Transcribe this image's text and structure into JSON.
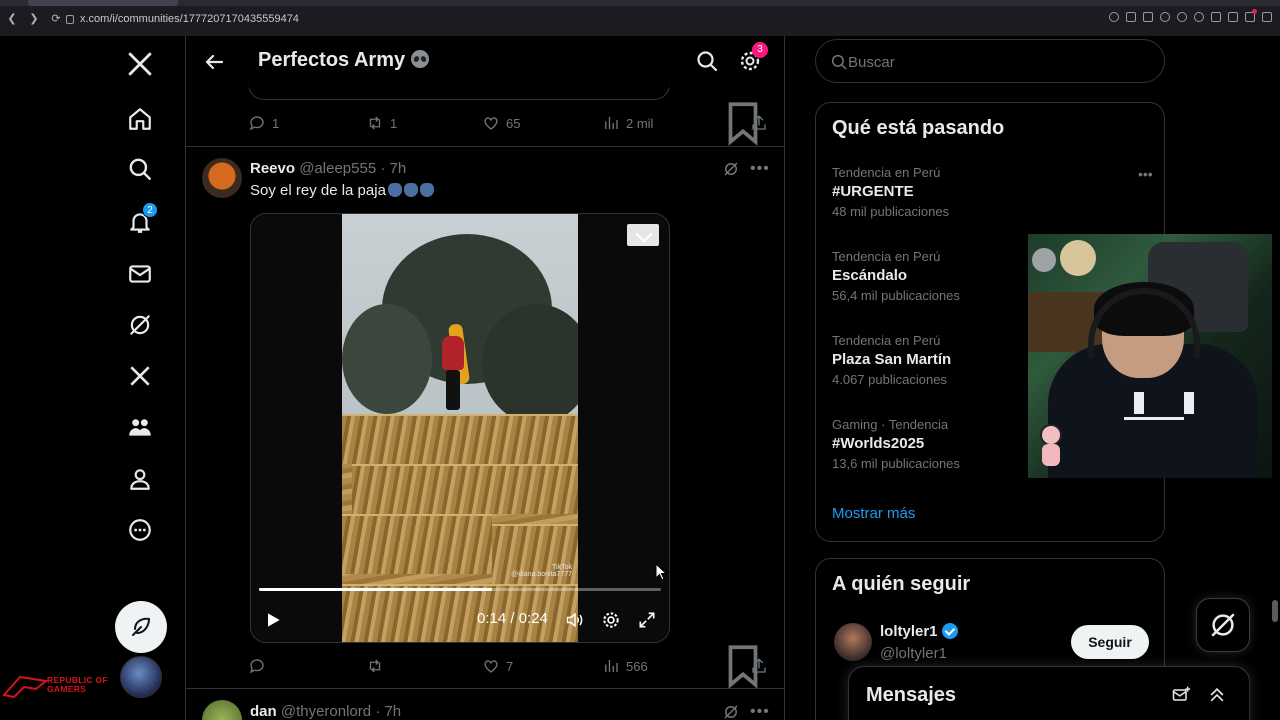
{
  "browser": {
    "url": "x.com/i/communities/1777207170435559474"
  },
  "nav": {
    "notifications_badge": "2",
    "profile_brand": "REPUBLIC OF GAMERS"
  },
  "header": {
    "title": "Perfectos Army",
    "settings_badge": "3"
  },
  "previous_tweet": {
    "replies": "1",
    "reposts": "1",
    "likes": "65",
    "views": "2 mil"
  },
  "tweet": {
    "name": "Reevo",
    "handle": "@aleep555",
    "time": "· 7h",
    "text": "Soy el rey de la paja",
    "video": {
      "time": "0:14 / 0:24",
      "progress": 0.58,
      "watermark_line1": "TikTok",
      "watermark_line2": "@diana.bonita7777"
    },
    "replies": "",
    "reposts": "",
    "likes": "7",
    "views": "566"
  },
  "next_tweet": {
    "name": "dan",
    "handle": "@thyeronlord",
    "time": "· 7h"
  },
  "search": {
    "placeholder": "Buscar"
  },
  "trends": {
    "title": "Qué está pasando",
    "items": [
      {
        "meta": "Tendencia en Perú",
        "topic": "#URGENTE",
        "count": "48 mil publicaciones"
      },
      {
        "meta": "Tendencia en Perú",
        "topic": "Escándalo",
        "count": "56,4 mil publicaciones"
      },
      {
        "meta": "Tendencia en Perú",
        "topic": "Plaza San Martín",
        "count": "4.067 publicaciones"
      },
      {
        "meta": "Gaming · Tendencia",
        "topic": "#Worlds2025",
        "count": "13,6 mil publicaciones"
      }
    ],
    "show_more": "Mostrar más"
  },
  "follow": {
    "title": "A quién seguir",
    "name": "loltyler1",
    "handle": "@loltyler1",
    "button": "Seguir"
  },
  "messages": {
    "title": "Mensajes"
  },
  "colors": {
    "accent": "#1d9bf0",
    "pink_badge": "#f91880",
    "text": "#e7e9ea",
    "muted": "#71767b",
    "border": "#2f3336"
  }
}
